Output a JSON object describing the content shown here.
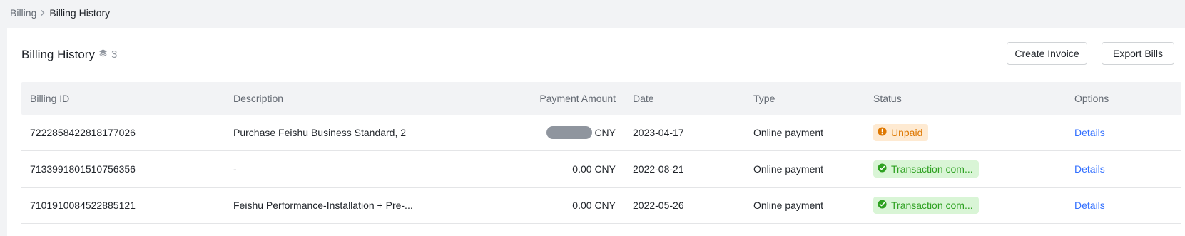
{
  "breadcrumb": {
    "parent": "Billing",
    "current": "Billing History"
  },
  "header": {
    "title": "Billing History",
    "count": "3"
  },
  "actions": {
    "create_invoice": "Create Invoice",
    "export_bills": "Export Bills"
  },
  "table": {
    "columns": {
      "billing_id": "Billing ID",
      "description": "Description",
      "payment_amount": "Payment Amount",
      "date": "Date",
      "type": "Type",
      "status": "Status",
      "options": "Options"
    },
    "rows": [
      {
        "billing_id": "7222858422818177026",
        "description": "Purchase Feishu Business Standard, 2",
        "amount": "",
        "currency": "CNY",
        "date": "2023-04-17",
        "type": "Online payment",
        "status": "Unpaid",
        "option": "Details"
      },
      {
        "billing_id": "7133991801510756356",
        "description": "-",
        "amount": "0.00",
        "currency": "CNY",
        "date": "2022-08-21",
        "type": "Online payment",
        "status": "Transaction com...",
        "option": "Details"
      },
      {
        "billing_id": "7101910084522885121",
        "description": "Feishu Performance-Installation + Pre-...",
        "amount": "0.00",
        "currency": "CNY",
        "date": "2022-05-26",
        "type": "Online payment",
        "status": "Transaction com...",
        "option": "Details"
      }
    ]
  },
  "colors": {
    "accent": "#3370ff",
    "unpaid": "#de7802",
    "success": "#2ea121"
  }
}
